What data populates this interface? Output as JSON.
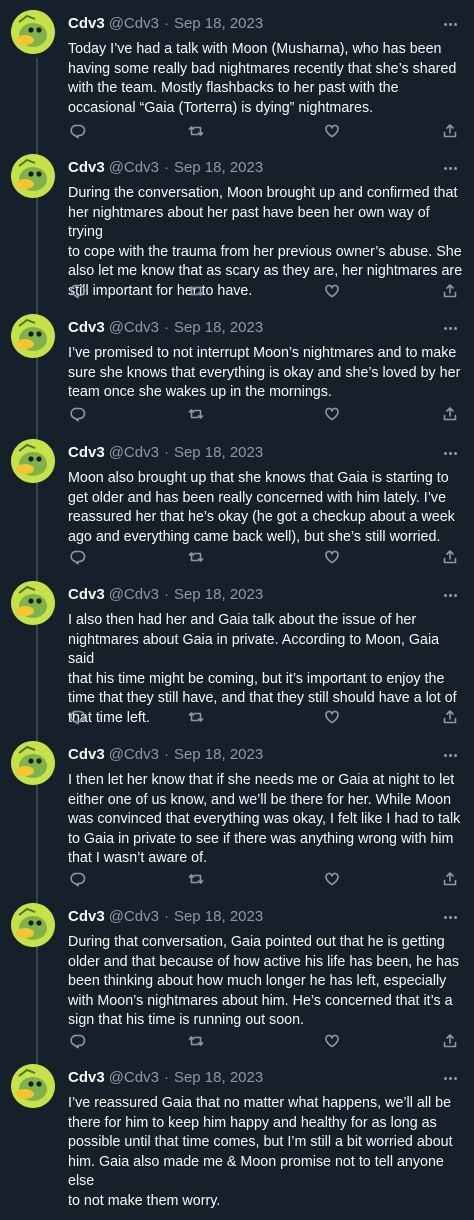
{
  "thread": {
    "tweets": [
      {
        "name": "Cdv3",
        "handle": "@Cdv3",
        "date": "Sep 18, 2023",
        "text": "Today I’ve had a talk with Moon (Musharna), who has been\nhaving some really bad nightmares recently that she’s shared\nwith the team. Mostly flashbacks to her past with the\noccasional “Gaia (Torterra) is dying” nightmares."
      },
      {
        "name": "Cdv3",
        "handle": "@Cdv3",
        "date": "Sep 18, 2023",
        "text": "During the conversation, Moon brought up and confirmed that\nher nightmares about her past have been her own way of trying\nto cope with the trauma from her previous owner’s abuse. She\nalso let me know that as scary as they are, her nightmares are\nstill important for her to have."
      },
      {
        "name": "Cdv3",
        "handle": "@Cdv3",
        "date": "Sep 18, 2023",
        "text": "I’ve promised to not interrupt Moon’s nightmares and to make\nsure she knows that everything is okay and she’s loved by her\nteam once she wakes up in the mornings."
      },
      {
        "name": "Cdv3",
        "handle": "@Cdv3",
        "date": "Sep 18, 2023",
        "text": "Moon also brought up that she knows that Gaia is starting to\nget older and has been really concerned with him lately. I’ve\nreassured her that he’s okay (he got a checkup about a week\nago and everything came back well), but she’s still worried."
      },
      {
        "name": "Cdv3",
        "handle": "@Cdv3",
        "date": "Sep 18, 2023",
        "text": "I also then had her and Gaia talk about the issue of her\nnightmares about Gaia in private. According to Moon, Gaia said\nthat his time might be coming, but it’s important to enjoy the\ntime that they still have, and that they still should have a lot of\nthat time left."
      },
      {
        "name": "Cdv3",
        "handle": "@Cdv3",
        "date": "Sep 18, 2023",
        "text": "I then let her know that if she needs me or Gaia at night to let\neither one of us know, and we’ll be there for her. While Moon\nwas convinced that everything was okay, I felt like I had to talk\nto Gaia in private to see if there was anything wrong with him\nthat I wasn’t aware of."
      },
      {
        "name": "Cdv3",
        "handle": "@Cdv3",
        "date": "Sep 18, 2023",
        "text": "During that conversation, Gaia pointed out that he is getting\nolder and that because of how active his life has been, he has\nbeen thinking about how much longer he has left, especially\nwith Moon’s nightmares about him. He’s concerned that it’s a\nsign that his time is running out soon."
      },
      {
        "name": "Cdv3",
        "handle": "@Cdv3",
        "date": "Sep 18, 2023",
        "text": "I’ve reassured Gaia that no matter what happens, we’ll all be\nthere for him to keep him happy and healthy for as long as\npossible until that time comes, but I’m still a bit worried about\nhim. Gaia also made me & Moon promise not to tell anyone else\nto not make them worry."
      }
    ]
  },
  "icons": {
    "reply": "reply-icon",
    "retweet": "retweet-icon",
    "like": "like-icon",
    "share": "share-icon",
    "more": "more-icon"
  },
  "colors": {
    "background": "#15202b",
    "text": "#f7f9f9",
    "muted": "#8b98a5",
    "rail": "#38444d",
    "avatar": "#c6e14a"
  }
}
